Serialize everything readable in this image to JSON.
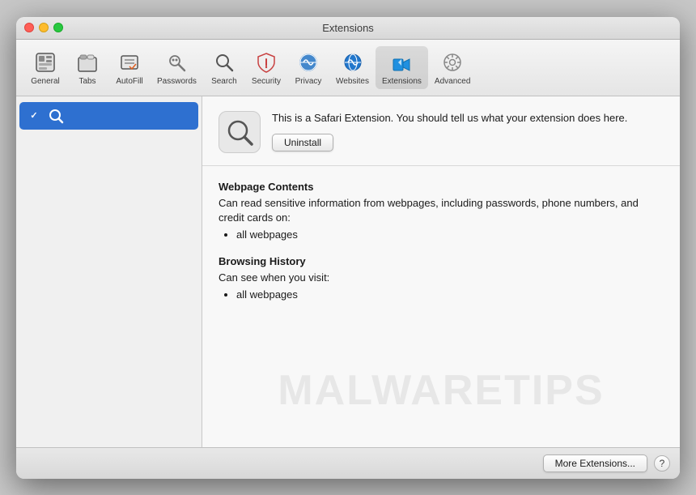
{
  "window": {
    "title": "Extensions"
  },
  "toolbar": {
    "items": [
      {
        "id": "general",
        "label": "General",
        "icon": "general-icon"
      },
      {
        "id": "tabs",
        "label": "Tabs",
        "icon": "tabs-icon"
      },
      {
        "id": "autofill",
        "label": "AutoFill",
        "icon": "autofill-icon"
      },
      {
        "id": "passwords",
        "label": "Passwords",
        "icon": "passwords-icon"
      },
      {
        "id": "search",
        "label": "Search",
        "icon": "search-icon"
      },
      {
        "id": "security",
        "label": "Security",
        "icon": "security-icon"
      },
      {
        "id": "privacy",
        "label": "Privacy",
        "icon": "privacy-icon"
      },
      {
        "id": "websites",
        "label": "Websites",
        "icon": "websites-icon"
      },
      {
        "id": "extensions",
        "label": "Extensions",
        "icon": "extensions-icon",
        "active": true
      },
      {
        "id": "advanced",
        "label": "Advanced",
        "icon": "advanced-icon"
      }
    ]
  },
  "sidebar": {
    "items": [
      {
        "id": "search-ext",
        "label": "",
        "checked": true,
        "selected": true
      }
    ]
  },
  "extension": {
    "description": "This is a Safari Extension. You should tell us what your extension does here.",
    "uninstall_label": "Uninstall",
    "permissions": [
      {
        "title": "Webpage Contents",
        "description": "Can read sensitive information from webpages, including passwords, phone numbers, and credit cards on:",
        "items": [
          "all webpages"
        ]
      },
      {
        "title": "Browsing History",
        "description": "Can see when you visit:",
        "items": [
          "all webpages"
        ]
      }
    ]
  },
  "bottom_bar": {
    "more_extensions_label": "More Extensions...",
    "help_label": "?"
  },
  "watermark": {
    "text": "MALWARETIPS"
  }
}
